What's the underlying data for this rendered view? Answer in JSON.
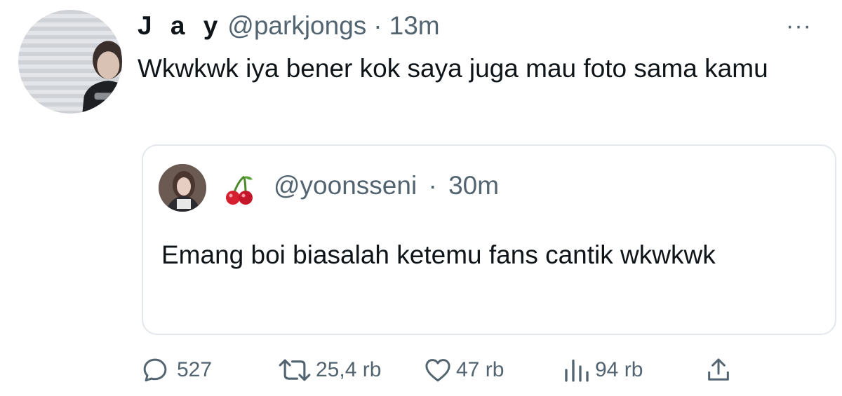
{
  "tweet": {
    "display_name": "J a y",
    "handle": "@parkjongs",
    "separator": "·",
    "time": "13m",
    "more_label": "···",
    "text": "Wkwkwk iya bener kok saya juga mau foto sama kamu"
  },
  "quoted_tweet": {
    "emoji_name": "cherries-emoji",
    "handle": "@yoonsseni",
    "separator": "·",
    "time": "30m",
    "text": "Emang boi biasalah ketemu fans cantik wkwkwk"
  },
  "actions": {
    "reply_count": "527",
    "retweet_count": "25,4 rb",
    "like_count": "47 rb",
    "views_count": "94 rb"
  },
  "icons": {
    "reply": "reply-icon",
    "retweet": "retweet-icon",
    "like": "heart-icon",
    "views": "views-icon",
    "share": "share-icon"
  },
  "colors": {
    "text": "#0f1419",
    "secondary": "#536471",
    "border": "#e4e8ec",
    "cherry": "#d6202f"
  }
}
